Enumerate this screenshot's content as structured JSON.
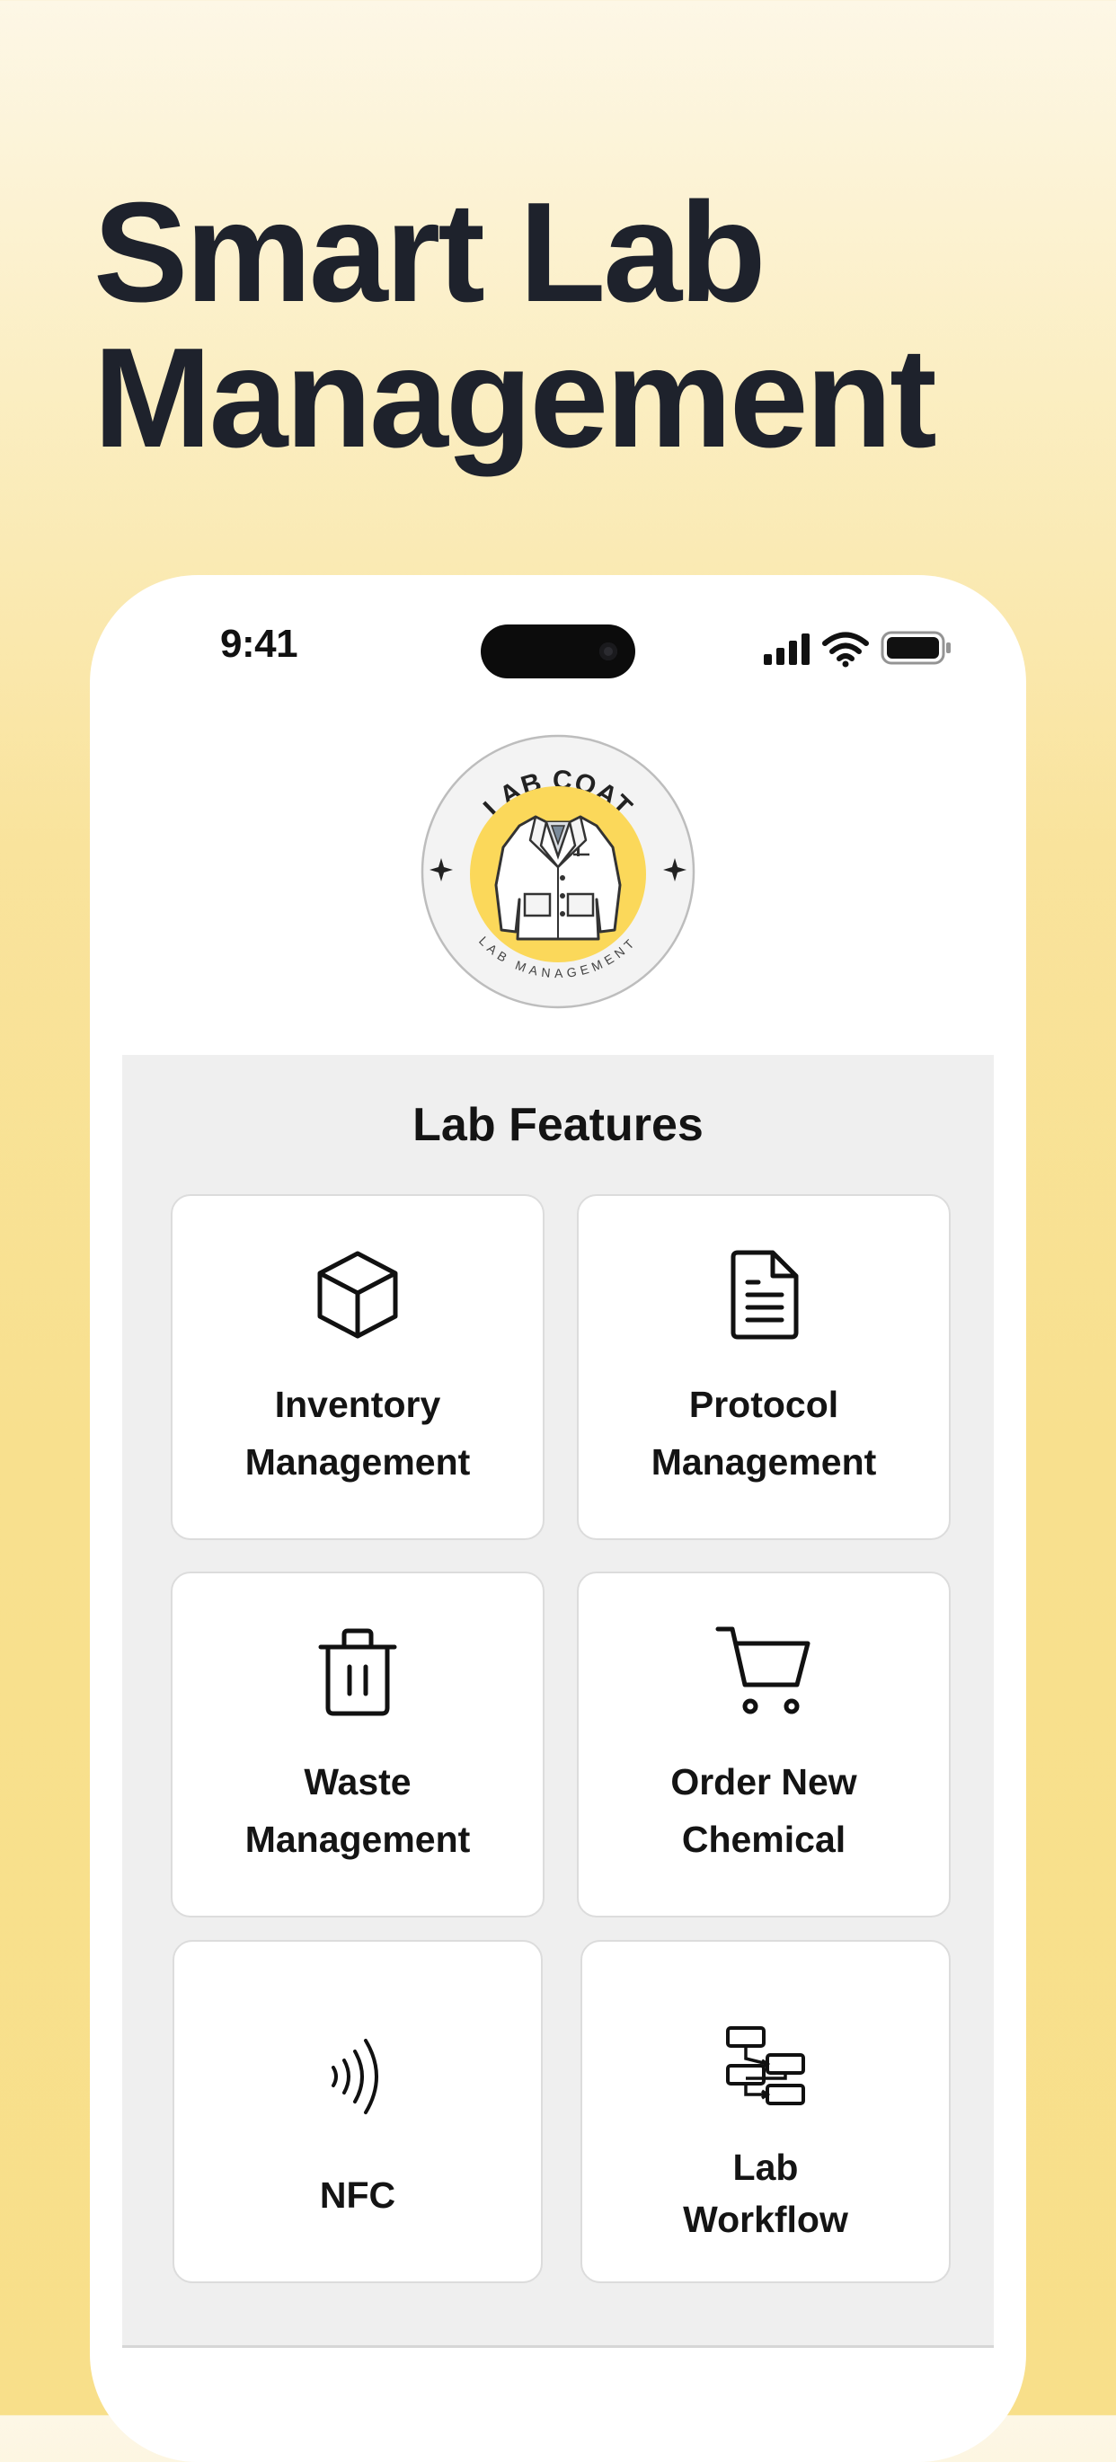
{
  "headline": {
    "line1": "Smart Lab",
    "line2": "Management"
  },
  "status_bar": {
    "time": "9:41",
    "icons": [
      "cellular-signal-icon",
      "wifi-icon",
      "battery-icon"
    ]
  },
  "logo": {
    "top_text": "LAB COAT",
    "bottom_text": "LAB MANAGEMENT",
    "image": "lab-coat-icon",
    "accent_color": "#fbd85a"
  },
  "features": {
    "title": "Lab Features",
    "items": [
      {
        "line1": "Inventory",
        "line2": "Management",
        "icon": "box-icon"
      },
      {
        "line1": "Protocol",
        "line2": "Management",
        "icon": "document-icon"
      },
      {
        "line1": "Waste",
        "line2": "Management",
        "icon": "trash-icon"
      },
      {
        "line1": "Order New",
        "line2": "Chemical",
        "icon": "cart-icon"
      },
      {
        "line1": "NFC",
        "line2": "",
        "icon": "nfc-icon"
      },
      {
        "line1": "Lab",
        "line2": "Workflow",
        "icon": "workflow-icon"
      }
    ]
  },
  "colors": {
    "background_top": "#fdf7e6",
    "background_bottom": "#f8df8a",
    "text": "#1e222c",
    "panel": "#efefef"
  }
}
